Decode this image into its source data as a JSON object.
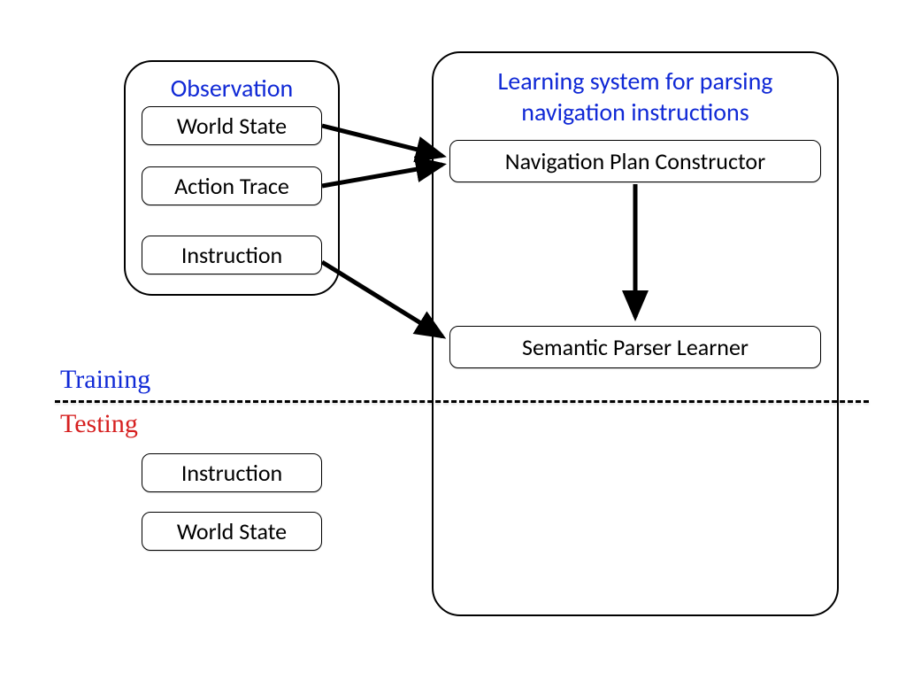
{
  "observation": {
    "title": "Observation",
    "world_state": "World State",
    "action_trace": "Action Trace",
    "instruction": "Instruction"
  },
  "learning_system": {
    "title_line1": "Learning system for parsing",
    "title_line2": "navigation instructions",
    "nav_plan_constructor": "Navigation Plan Constructor",
    "semantic_parser_learner": "Semantic Parser Learner"
  },
  "phases": {
    "training": "Training",
    "testing": "Testing"
  },
  "testing_inputs": {
    "instruction": "Instruction",
    "world_state": "World State"
  }
}
